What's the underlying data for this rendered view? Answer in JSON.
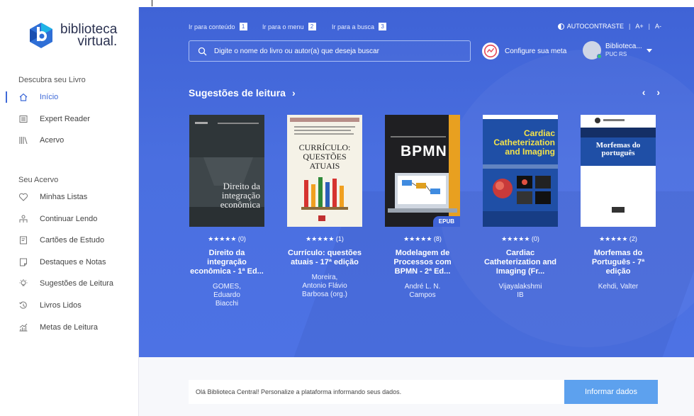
{
  "logo": {
    "line1": "biblioteca",
    "line2": "virtual."
  },
  "sidebar": {
    "discover_title": "Descubra seu Livro",
    "discover_items": [
      {
        "label": "Início",
        "icon": "home-icon",
        "active": true
      },
      {
        "label": "Expert Reader",
        "icon": "list-icon"
      },
      {
        "label": "Acervo",
        "icon": "library-icon"
      }
    ],
    "collection_title": "Seu Acervo",
    "collection_items": [
      {
        "label": "Minhas Listas",
        "icon": "heart-icon"
      },
      {
        "label": "Continuar Lendo",
        "icon": "reader-icon"
      },
      {
        "label": "Cartões de Estudo",
        "icon": "flashcard-icon"
      },
      {
        "label": "Destaques e Notas",
        "icon": "notes-icon"
      },
      {
        "label": "Sugestões de Leitura",
        "icon": "lightbulb-icon"
      },
      {
        "label": "Livros Lidos",
        "icon": "history-icon"
      },
      {
        "label": "Metas de Leitura",
        "icon": "chart-icon"
      }
    ]
  },
  "header": {
    "skip_links": [
      {
        "label": "Ir para conteúdo",
        "key": "1"
      },
      {
        "label": "Ir para o menu",
        "key": "2"
      },
      {
        "label": "Ir para a busca",
        "key": "3"
      }
    ],
    "contrast_label": "AUTOCONTRASTE",
    "font_up": "A+",
    "font_down": "A-",
    "search_placeholder": "Digite o nome do livro ou autor(a) que deseja buscar",
    "goal_label": "Configure sua meta",
    "user_name": "Biblioteca...",
    "user_org": "PUC RS"
  },
  "suggestions": {
    "title": "Sugestões de leitura",
    "books": [
      {
        "title_lines": [
          "Direito da",
          "integração",
          "econômica - 1ª Ed..."
        ],
        "author_lines": [
          "GOMES,",
          "Eduardo",
          "Biacchi"
        ],
        "rating_count": "(0)",
        "epub": "",
        "cover_title": "Direito da integração econômica"
      },
      {
        "title_lines": [
          "Currículo: questões",
          "atuais - 17ª edição"
        ],
        "author_lines": [
          "Moreira,",
          "Antonio Flávio",
          "Barbosa (org.)"
        ],
        "rating_count": "(1)",
        "epub": "",
        "cover_title": "CURRÍCULO: QUESTÕES ATUAIS"
      },
      {
        "title_lines": [
          "Modelagem de",
          "Processos com",
          "BPMN - 2ª Ed..."
        ],
        "author_lines": [
          "André L. N.",
          "Campos"
        ],
        "rating_count": "(8)",
        "epub": "EPUB",
        "cover_title": "BPMN"
      },
      {
        "title_lines": [
          "Cardiac",
          "Catheterization and",
          "Imaging (Fr..."
        ],
        "author_lines": [
          "Vijayalakshmi",
          "IB"
        ],
        "rating_count": "(0)",
        "epub": "",
        "cover_title": "Cardiac Catheterization and Imaging"
      },
      {
        "title_lines": [
          "Morfemas do",
          "Português - 7ª",
          "edição"
        ],
        "author_lines": [
          "Kehdi, Valter"
        ],
        "rating_count": "(2)",
        "epub": "",
        "cover_title": "Morfemas do português"
      }
    ]
  },
  "footer": {
    "notice": "Olá Biblioteca Central! Personalize a plataforma informando seus dados.",
    "button": "Informar dados"
  },
  "colors": {
    "hero": "#4a6fe0",
    "accent": "#3f6ad8",
    "button": "#5da1ee"
  }
}
